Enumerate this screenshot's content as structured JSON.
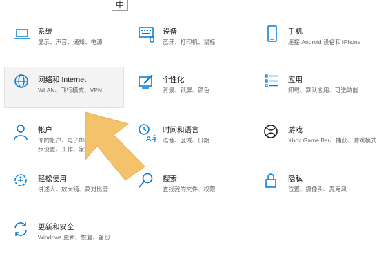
{
  "top_box": {
    "label": "中"
  },
  "tiles": [
    {
      "title": "系统",
      "desc": "显示、声音、通知、电源"
    },
    {
      "title": "设备",
      "desc": "蓝牙、打印机、鼠标"
    },
    {
      "title": "手机",
      "desc": "连接 Android 设备和 iPhone"
    },
    {
      "title": "网络和 Internet",
      "desc": "WLAN、飞行模式、VPN"
    },
    {
      "title": "个性化",
      "desc": "背景、锁屏、颜色"
    },
    {
      "title": "应用",
      "desc": "卸载、默认应用、可选功能"
    },
    {
      "title": "帐户",
      "desc": "你的帐户、电子邮件、同步设置、工作、家庭"
    },
    {
      "title": "时间和语言",
      "desc": "语音、区域、日期"
    },
    {
      "title": "游戏",
      "desc": "Xbox Game Bar、捕获、游戏模式"
    },
    {
      "title": "轻松使用",
      "desc": "讲述人、放大镜、高对比度"
    },
    {
      "title": "搜索",
      "desc": "查找我的文件、权限"
    },
    {
      "title": "隐私",
      "desc": "位置、摄像头、麦克风"
    },
    {
      "title": "更新和安全",
      "desc": "Windows 更新、恢复、备份"
    }
  ],
  "colors": {
    "icon_blue": "#0078d4",
    "arrow": "#f4c26b"
  }
}
